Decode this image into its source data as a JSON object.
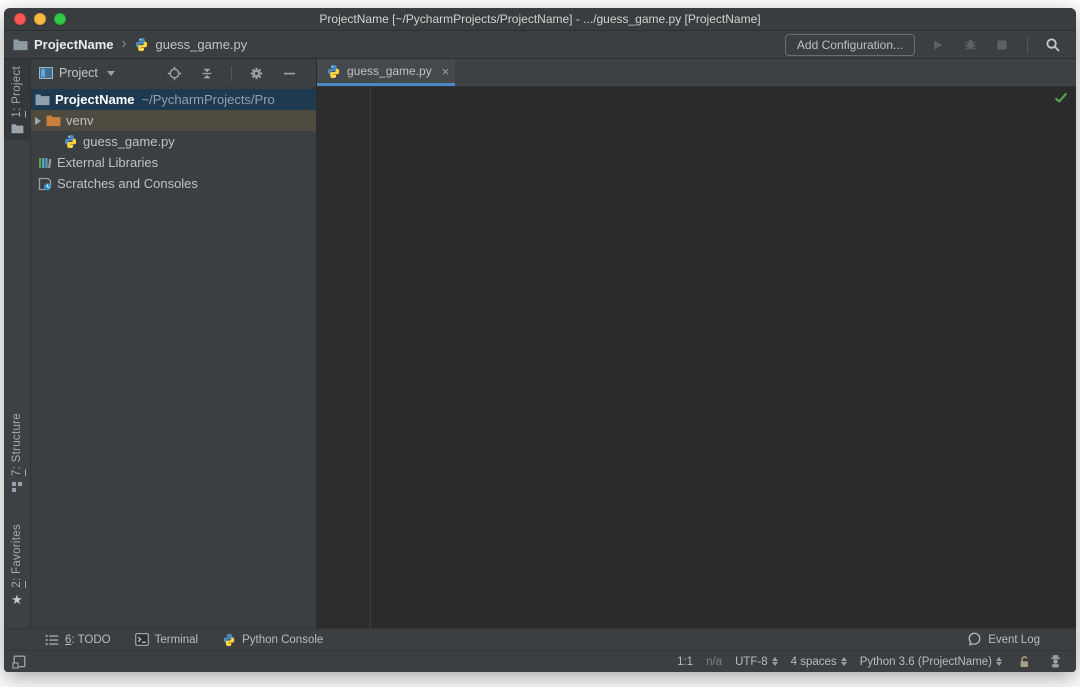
{
  "window": {
    "title": "ProjectName [~/PycharmProjects/ProjectName] - .../guess_game.py [ProjectName]",
    "traffic_lights": {
      "close": "#fc5753",
      "minimize": "#fdbc40",
      "zoom": "#33c748"
    }
  },
  "navbar": {
    "breadcrumb_project": "ProjectName",
    "breadcrumb_file": "guess_game.py",
    "add_configuration": "Add Configuration...",
    "icons": [
      "run-icon",
      "debug-icon",
      "stop-icon",
      "search-icon"
    ]
  },
  "stripe": {
    "project": {
      "mnemonic": "1",
      "rest": ": Project",
      "icon": "folder-icon"
    },
    "structure": {
      "mnemonic": "7",
      "rest": ": Structure",
      "icon": "structure-icon"
    },
    "favorites": {
      "mnemonic": "2",
      "rest": ": Favorites",
      "icon": "star-icon"
    }
  },
  "panel": {
    "header_title": "Project",
    "header_icons": [
      "locate-icon",
      "collapse-all-icon",
      "settings-gear-icon",
      "hide-icon"
    ],
    "tree": [
      {
        "name": "ProjectName",
        "path": "~/PycharmProjects/Pro",
        "icon": "folder-icon",
        "selected": true
      },
      {
        "name": "venv",
        "icon": "folder-icon-orange",
        "expandable": true
      },
      {
        "name": "guess_game.py",
        "icon": "python-file-icon"
      },
      {
        "name": "External Libraries",
        "icon": "libraries-icon"
      },
      {
        "name": "Scratches and Consoles",
        "icon": "scratches-icon"
      }
    ]
  },
  "editor": {
    "tab_label": "guess_game.py",
    "inspection_status": "no-problems-check"
  },
  "bottom_bar": {
    "todo": {
      "mnemonic": "6",
      "rest": ": TODO"
    },
    "terminal": "Terminal",
    "python_console": "Python Console",
    "event_log": "Event Log"
  },
  "status_bar": {
    "caret_position": "1:1",
    "line_separator": "n/a",
    "encoding": "UTF-8",
    "indent": "4 spaces",
    "interpreter": "Python 3.6 (ProjectName)"
  },
  "glyphs": {
    "breadcrumb_separator": "›",
    "tab_close": "×",
    "favorites_star": "★"
  },
  "colors": {
    "tab_underline": "#4A88C7",
    "tree_selection": "#1e3a50",
    "venv_highlight": "#4e4a40",
    "check_green": "#53a657",
    "folder_orange": "#c9803c",
    "python_blue": "#4b8bbe",
    "python_yellow": "#ffd43b",
    "panel_bg": "#3c3f41",
    "editor_bg": "#2b2b2b"
  }
}
